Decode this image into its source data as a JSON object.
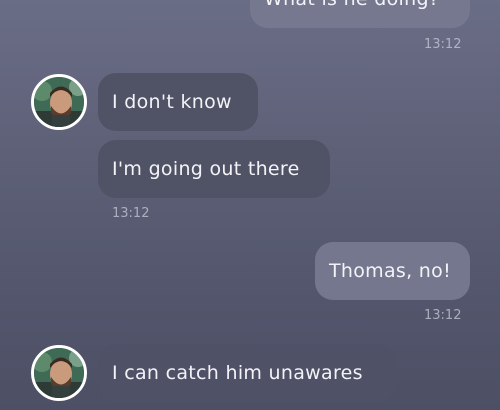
{
  "conversation": {
    "messages": [
      {
        "id": "m1",
        "direction": "outgoing",
        "text": "What is he doing?",
        "time": "13:12"
      },
      {
        "id": "m2",
        "direction": "incoming",
        "text": "I don't know"
      },
      {
        "id": "m3",
        "direction": "incoming",
        "text": "I'm going out there",
        "time": "13:12"
      },
      {
        "id": "m4",
        "direction": "outgoing",
        "text": "Thomas, no!",
        "time": "13:12"
      },
      {
        "id": "m5",
        "direction": "incoming",
        "text": "I can catch him unawares"
      }
    ]
  },
  "avatar_icon": "contact-photo-icon",
  "colors": {
    "background_top": "#6a6d86",
    "background_bottom": "#4d5065",
    "bubble_outgoing": "#76798f",
    "bubble_incoming": "#505366",
    "timestamp": "#cdcfdc"
  }
}
